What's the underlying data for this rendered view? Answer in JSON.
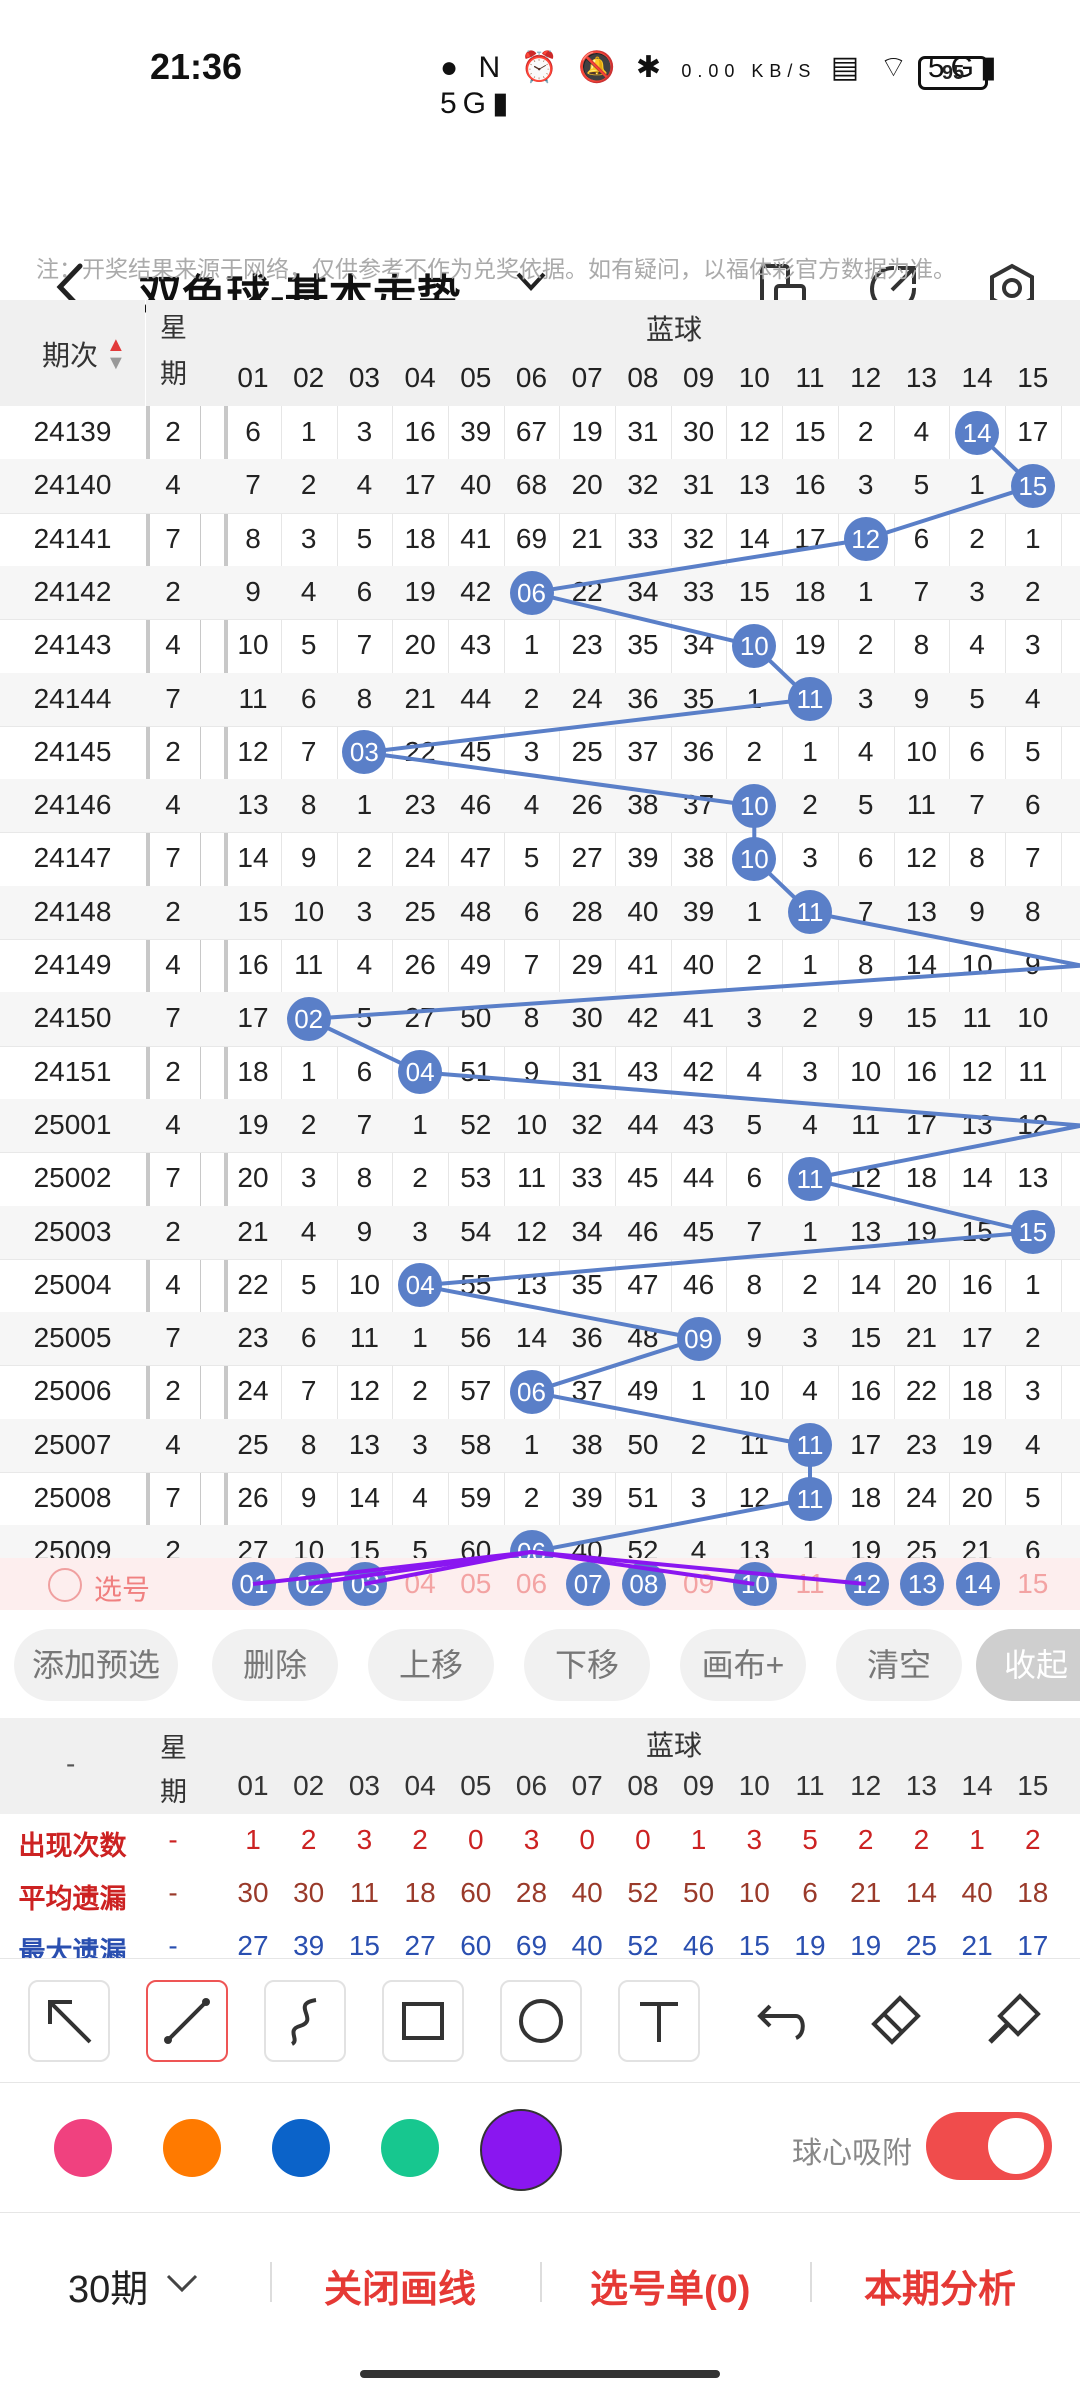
{
  "status_bar": {
    "time": "21:36",
    "network_speed": "0.00 KB/S",
    "battery": "95"
  },
  "header": {
    "title": "双色球-基本走势"
  },
  "notice": "注：开奖结果来源于网络，仅供参考不作为兑奖依据。如有疑问，以福体彩官方数据为准。",
  "grid_headers": {
    "issue": "期次",
    "week_top": "星",
    "week_bottom": "期",
    "section": "蓝球",
    "cols": [
      "01",
      "02",
      "03",
      "04",
      "05",
      "06",
      "07",
      "08",
      "09",
      "10",
      "11",
      "12",
      "13",
      "14",
      "15"
    ]
  },
  "draws": [
    {
      "issue": "24139",
      "week": "2",
      "vals": [
        "6",
        "1",
        "3",
        "16",
        "39",
        "67",
        "19",
        "31",
        "30",
        "12",
        "15",
        "2",
        "4",
        "14",
        "17"
      ],
      "hit": 14
    },
    {
      "issue": "24140",
      "week": "4",
      "vals": [
        "7",
        "2",
        "4",
        "17",
        "40",
        "68",
        "20",
        "32",
        "31",
        "13",
        "16",
        "3",
        "5",
        "1",
        "15"
      ],
      "hit": 15
    },
    {
      "issue": "24141",
      "week": "7",
      "vals": [
        "8",
        "3",
        "5",
        "18",
        "41",
        "69",
        "21",
        "33",
        "32",
        "14",
        "17",
        "12",
        "6",
        "2",
        "1"
      ],
      "hit": 12
    },
    {
      "issue": "24142",
      "week": "2",
      "vals": [
        "9",
        "4",
        "6",
        "19",
        "42",
        "06",
        "22",
        "34",
        "33",
        "15",
        "18",
        "1",
        "7",
        "3",
        "2"
      ],
      "hit": 6
    },
    {
      "issue": "24143",
      "week": "4",
      "vals": [
        "10",
        "5",
        "7",
        "20",
        "43",
        "1",
        "23",
        "35",
        "34",
        "10",
        "19",
        "2",
        "8",
        "4",
        "3"
      ],
      "hit": 10
    },
    {
      "issue": "24144",
      "week": "7",
      "vals": [
        "11",
        "6",
        "8",
        "21",
        "44",
        "2",
        "24",
        "36",
        "35",
        "1",
        "11",
        "3",
        "9",
        "5",
        "4"
      ],
      "hit": 11
    },
    {
      "issue": "24145",
      "week": "2",
      "vals": [
        "12",
        "7",
        "03",
        "22",
        "45",
        "3",
        "25",
        "37",
        "36",
        "2",
        "1",
        "4",
        "10",
        "6",
        "5"
      ],
      "hit": 3
    },
    {
      "issue": "24146",
      "week": "4",
      "vals": [
        "13",
        "8",
        "1",
        "23",
        "46",
        "4",
        "26",
        "38",
        "37",
        "10",
        "2",
        "5",
        "11",
        "7",
        "6"
      ],
      "hit": 10
    },
    {
      "issue": "24147",
      "week": "7",
      "vals": [
        "14",
        "9",
        "2",
        "24",
        "47",
        "5",
        "27",
        "39",
        "38",
        "10",
        "3",
        "6",
        "12",
        "8",
        "7"
      ],
      "hit": 10
    },
    {
      "issue": "24148",
      "week": "2",
      "vals": [
        "15",
        "10",
        "3",
        "25",
        "48",
        "6",
        "28",
        "40",
        "39",
        "1",
        "11",
        "7",
        "13",
        "9",
        "8"
      ],
      "hit": 11
    },
    {
      "issue": "24149",
      "week": "4",
      "vals": [
        "16",
        "11",
        "4",
        "26",
        "49",
        "7",
        "29",
        "41",
        "40",
        "2",
        "1",
        "8",
        "14",
        "10",
        "9"
      ],
      "hit": 0
    },
    {
      "issue": "24150",
      "week": "7",
      "vals": [
        "17",
        "02",
        "5",
        "27",
        "50",
        "8",
        "30",
        "42",
        "41",
        "3",
        "2",
        "9",
        "15",
        "11",
        "10"
      ],
      "hit": 2
    },
    {
      "issue": "24151",
      "week": "2",
      "vals": [
        "18",
        "1",
        "6",
        "04",
        "51",
        "9",
        "31",
        "43",
        "42",
        "4",
        "3",
        "10",
        "16",
        "12",
        "11"
      ],
      "hit": 4
    },
    {
      "issue": "25001",
      "week": "4",
      "vals": [
        "19",
        "2",
        "7",
        "1",
        "52",
        "10",
        "32",
        "44",
        "43",
        "5",
        "4",
        "11",
        "17",
        "13",
        "12"
      ],
      "hit": 0
    },
    {
      "issue": "25002",
      "week": "7",
      "vals": [
        "20",
        "3",
        "8",
        "2",
        "53",
        "11",
        "33",
        "45",
        "44",
        "6",
        "11",
        "12",
        "18",
        "14",
        "13"
      ],
      "hit": 11
    },
    {
      "issue": "25003",
      "week": "2",
      "vals": [
        "21",
        "4",
        "9",
        "3",
        "54",
        "12",
        "34",
        "46",
        "45",
        "7",
        "1",
        "13",
        "19",
        "15",
        "15"
      ],
      "hit": 15
    },
    {
      "issue": "25004",
      "week": "4",
      "vals": [
        "22",
        "5",
        "10",
        "04",
        "55",
        "13",
        "35",
        "47",
        "46",
        "8",
        "2",
        "14",
        "20",
        "16",
        "1"
      ],
      "hit": 4
    },
    {
      "issue": "25005",
      "week": "7",
      "vals": [
        "23",
        "6",
        "11",
        "1",
        "56",
        "14",
        "36",
        "48",
        "09",
        "9",
        "3",
        "15",
        "21",
        "17",
        "2"
      ],
      "hit": 9
    },
    {
      "issue": "25006",
      "week": "2",
      "vals": [
        "24",
        "7",
        "12",
        "2",
        "57",
        "06",
        "37",
        "49",
        "1",
        "10",
        "4",
        "16",
        "22",
        "18",
        "3"
      ],
      "hit": 6
    },
    {
      "issue": "25007",
      "week": "4",
      "vals": [
        "25",
        "8",
        "13",
        "3",
        "58",
        "1",
        "38",
        "50",
        "2",
        "11",
        "11",
        "17",
        "23",
        "19",
        "4"
      ],
      "hit": 11
    },
    {
      "issue": "25008",
      "week": "7",
      "vals": [
        "26",
        "9",
        "14",
        "4",
        "59",
        "2",
        "39",
        "51",
        "3",
        "12",
        "11",
        "18",
        "24",
        "20",
        "5"
      ],
      "hit": 11
    },
    {
      "issue": "25009",
      "week": "2",
      "vals": [
        "27",
        "10",
        "15",
        "5",
        "60",
        "06",
        "40",
        "52",
        "4",
        "13",
        "1",
        "19",
        "25",
        "21",
        "6"
      ],
      "hit": 6
    }
  ],
  "select_row": {
    "label": "选号",
    "numbers": [
      "01",
      "02",
      "03",
      "04",
      "05",
      "06",
      "07",
      "08",
      "09",
      "10",
      "11",
      "12",
      "13",
      "14",
      "15"
    ]
  },
  "actions": {
    "add_preselect": "添加预选",
    "delete": "删除",
    "move_up": "上移",
    "move_down": "下移",
    "canvas_plus": "画布+",
    "clear": "清空",
    "collapse": "收起"
  },
  "stats": {
    "header_dash": "-",
    "rows": [
      {
        "label": "出现次数",
        "week": "-",
        "vals": [
          "1",
          "2",
          "3",
          "2",
          "0",
          "3",
          "0",
          "0",
          "1",
          "3",
          "5",
          "2",
          "2",
          "1",
          "2"
        ],
        "color": "#cc2222"
      },
      {
        "label": "平均遗漏",
        "week": "-",
        "vals": [
          "30",
          "30",
          "11",
          "18",
          "60",
          "28",
          "40",
          "52",
          "50",
          "10",
          "6",
          "21",
          "14",
          "40",
          "18"
        ],
        "color": "#9a3a2a"
      },
      {
        "label": "最大遗漏",
        "week": "-",
        "vals": [
          "27",
          "39",
          "15",
          "27",
          "60",
          "69",
          "40",
          "52",
          "46",
          "15",
          "19",
          "19",
          "25",
          "21",
          "17"
        ],
        "color": "#2a4fb0"
      }
    ]
  },
  "tools": [
    "arrow-tool",
    "line-tool",
    "freehand-tool",
    "rectangle-tool",
    "circle-tool",
    "text-tool",
    "undo-tool",
    "eraser-tool",
    "brush-tool"
  ],
  "colors": [
    "#f0417f",
    "#ff7a00",
    "#0b63c9",
    "#17c78f",
    "#8a16f0"
  ],
  "snap": {
    "label": "球心吸附",
    "on": true
  },
  "bottom": {
    "periods": "30期",
    "close_draw": "关闭画线",
    "pick_list": "选号单(0)",
    "analysis": "本期分析"
  }
}
